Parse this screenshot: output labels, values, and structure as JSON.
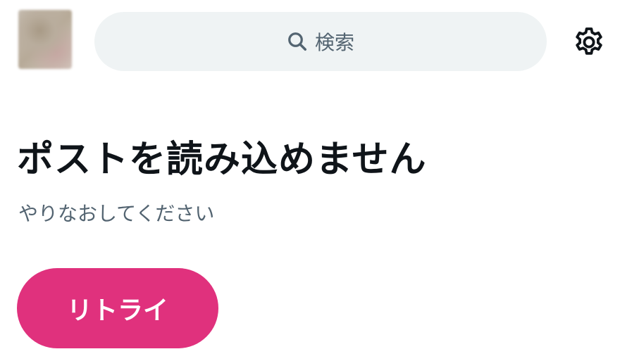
{
  "header": {
    "avatar_icon": "profile-avatar",
    "search": {
      "icon": "search-icon",
      "placeholder": "検索"
    },
    "settings_icon": "gear-icon"
  },
  "error": {
    "title": "ポストを読み込めません",
    "subtitle": "やりなおしてください",
    "retry_label": "リトライ"
  },
  "colors": {
    "accent": "#e0317d",
    "search_background": "#eff3f4",
    "title_text": "#0f1419",
    "secondary_text": "#536471"
  }
}
